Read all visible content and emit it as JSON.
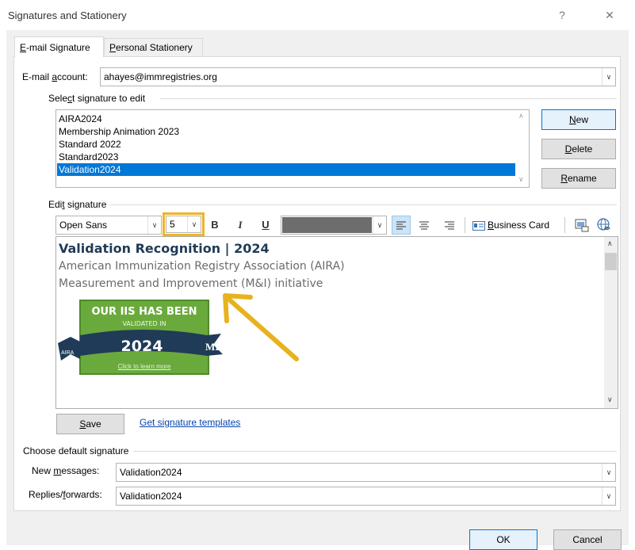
{
  "window": {
    "title": "Signatures and Stationery",
    "help_glyph": "?",
    "close_glyph": "✕"
  },
  "tabs": [
    {
      "label_pre": "",
      "label_acc": "E",
      "label_post": "-mail Signature"
    },
    {
      "label_pre": "",
      "label_acc": "P",
      "label_post": "ersonal Stationery"
    }
  ],
  "account": {
    "label_pre": "E-mail ",
    "label_acc": "a",
    "label_post": "ccount:",
    "value": "ahayes@immregistries.org"
  },
  "select_group": {
    "label_pre": "Sele",
    "label_acc": "c",
    "label_post": "t signature to edit"
  },
  "signatures": [
    {
      "name": "AIRA2024"
    },
    {
      "name": "Membership Animation 2023"
    },
    {
      "name": "Standard 2022"
    },
    {
      "name": "Standard2023"
    },
    {
      "name": "Validation2024"
    }
  ],
  "side_buttons": {
    "new": {
      "pre": "",
      "acc": "N",
      "post": "ew"
    },
    "delete": {
      "pre": "",
      "acc": "D",
      "post": "elete"
    },
    "rename": {
      "pre": "",
      "acc": "R",
      "post": "ename"
    }
  },
  "edit_group": {
    "label_pre": "Edi",
    "label_acc": "t",
    "label_post": " signature"
  },
  "toolbar": {
    "font_name": "Open Sans",
    "font_size": "5",
    "bold": "B",
    "italic": "I",
    "underline": "U",
    "business_card_pre": "",
    "business_card_acc": "B",
    "business_card_post": "usiness Card",
    "highlight_color": "#ecb52a",
    "font_color": "#6d6d6d"
  },
  "signature_content": {
    "heading": "Validation Recognition | 2024",
    "line2": "American Immunization Registry Association (AIRA)",
    "line3": "Measurement and Improvement (M&I) initiative",
    "badge": {
      "line1": "OUR IIS HAS BEEN",
      "line2": "VALIDATED IN",
      "year": "2024",
      "left_logo": "AIRA",
      "right_logo": "MI",
      "link": "Click to learn more",
      "bg_color": "#6aaa3c",
      "ribbon_color": "#1f3b57"
    },
    "arrow_color": "#e8b21e"
  },
  "below_editor": {
    "save_pre": "",
    "save_acc": "S",
    "save_post": "ave",
    "templates_link": "Get signature templates"
  },
  "default_sig": {
    "label": "Choose default signature",
    "new_messages": {
      "pre": "New ",
      "acc": "m",
      "post": "essages:",
      "value": "Validation2024"
    },
    "replies": {
      "pre": "Replies/",
      "acc": "f",
      "post": "orwards:",
      "value": "Validation2024"
    }
  },
  "footer": {
    "ok": "OK",
    "cancel": "Cancel"
  }
}
